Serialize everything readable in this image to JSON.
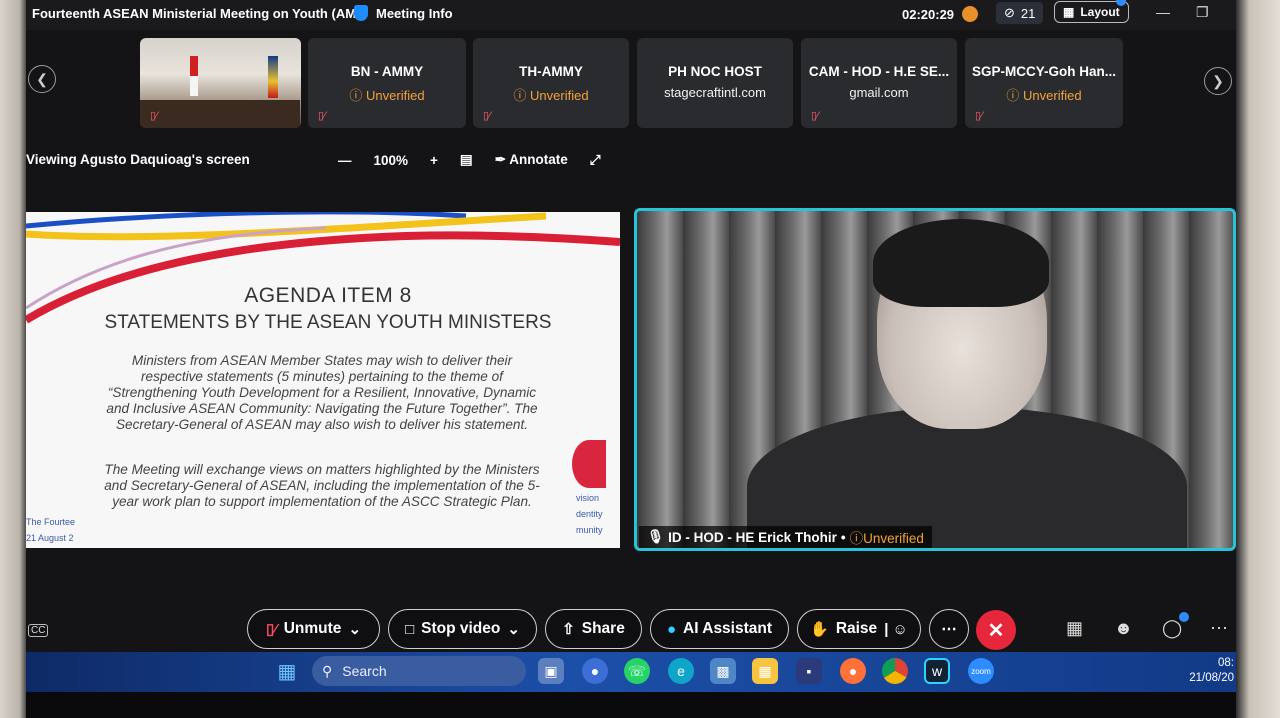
{
  "window": {
    "title": "Fourteenth ASEAN Ministerial Meeting on Youth (AM...",
    "meeting_info": "Meeting Info",
    "timer": "02:20:29",
    "participants_count": "21",
    "layout_label": "Layout"
  },
  "participants": [
    {
      "name": "BN - AMMY",
      "status": "Unverified"
    },
    {
      "name": "TH-AMMY",
      "status": "Unverified"
    },
    {
      "name": "PH NOC HOST",
      "status": "stagecraftintl.com"
    },
    {
      "name": "CAM - HOD - H.E SE...",
      "status": "gmail.com"
    },
    {
      "name": "SGP-MCCY-Goh Han...",
      "status": "Unverified"
    }
  ],
  "view": {
    "viewing_label": "Viewing Agusto Daquioag's screen",
    "zoom": "100%",
    "annotate": "Annotate"
  },
  "slide": {
    "heading1": "AGENDA ITEM 8",
    "heading2": "STATEMENTS BY THE ASEAN YOUTH MINISTERS",
    "para1_lines": [
      "Ministers from ASEAN Member States may wish to deliver their",
      "respective statements (5 minutes) pertaining to the theme of",
      "“Strengthening Youth Development for a Resilient, Innovative, Dynamic",
      "and Inclusive ASEAN Community: Navigating the Future Together”. The",
      "Secretary-General of ASEAN may also wish to deliver his statement."
    ],
    "para2_lines": [
      "The Meeting will exchange views on matters highlighted by the Ministers",
      "and Secretary-General of ASEAN, including the implementation of the 5-",
      "year work plan to support implementation of the ASCC Strategic Plan."
    ],
    "frag_left": [
      "The Fourtee",
      "21 August 2"
    ],
    "frag_right": [
      "vision",
      "dentity",
      "munity"
    ]
  },
  "speaker": {
    "name": "ID - HOD - HE Erick Thohir",
    "status": "Unverified"
  },
  "controls": {
    "unmute": "Unmute",
    "stop_video": "Stop video",
    "share": "Share",
    "ai_assistant": "AI Assistant",
    "raise": "Raise"
  },
  "taskbar": {
    "search": "Search",
    "time": "08:",
    "date": "21/08/20"
  },
  "colors": {
    "accent_border": "#27c3d9",
    "unverified": "#f2a23a",
    "end_button": "#e6263a"
  }
}
